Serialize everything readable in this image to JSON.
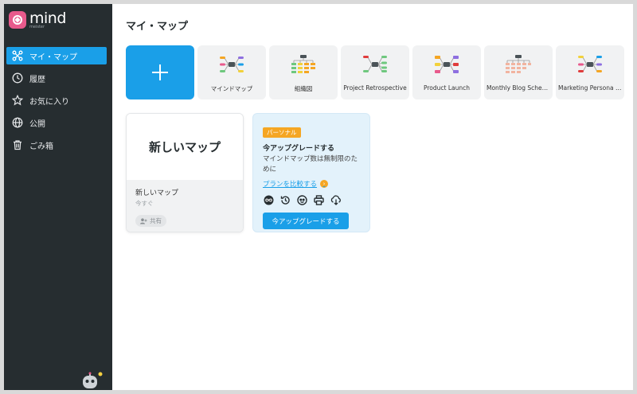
{
  "app": {
    "name": "mind",
    "sub": "meister"
  },
  "sidebar": {
    "items": [
      {
        "label": "マイ・マップ",
        "icon": "mindmap-icon",
        "active": true
      },
      {
        "label": "履歴",
        "icon": "clock-icon"
      },
      {
        "label": "お気に入り",
        "icon": "star-icon"
      },
      {
        "label": "公開",
        "icon": "globe-icon"
      },
      {
        "label": "ごみ箱",
        "icon": "trash-icon"
      }
    ]
  },
  "main": {
    "title": "マイ・マップ",
    "templates": [
      {
        "label": "マインドマップ"
      },
      {
        "label": "組織図"
      },
      {
        "label": "Project Retrospective"
      },
      {
        "label": "Product Launch"
      },
      {
        "label": "Monthly Blog Schedule"
      },
      {
        "label": "Marketing Persona Template"
      }
    ],
    "map_card": {
      "preview_title": "新しいマップ",
      "name": "新しいマップ",
      "time": "今すぐ",
      "share_label": "共有"
    },
    "upgrade": {
      "badge": "パーソナル",
      "title": "今アップグレードする",
      "desc": "マインドマップ数は無制限のために",
      "link": "プランを比較する",
      "button": "今アップグレードする"
    }
  },
  "colors": {
    "sidebar_bg": "#262d30",
    "accent": "#1a9fe8",
    "badge": "#f5a623",
    "upgrade_bg": "#e3f2fb",
    "brand": "#e85a8c"
  }
}
